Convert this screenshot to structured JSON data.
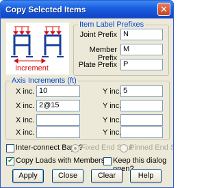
{
  "window": {
    "title": "Copy Selected Items"
  },
  "diagram": {
    "caption": "Increment"
  },
  "prefixes": {
    "legend": "Item Label Prefixes",
    "joint_label": "Joint Prefix",
    "joint_value": "N",
    "member_label": "Member Prefix",
    "member_value": "M",
    "plate_label": "Plate Prefix",
    "plate_value": "P"
  },
  "increments": {
    "legend": "Axis Increments (ft)",
    "rows": [
      {
        "x_label": "X inc.",
        "x_value": "10",
        "y_label": "Y inc.",
        "y_value": "5"
      },
      {
        "x_label": "X inc.",
        "x_value": "2@15",
        "y_label": "Y inc.",
        "y_value": ""
      },
      {
        "x_label": "X inc.",
        "x_value": "",
        "y_label": "Y inc.",
        "y_value": ""
      },
      {
        "x_label": "X inc.",
        "x_value": "",
        "y_label": "Y inc.",
        "y_value": ""
      }
    ]
  },
  "options": {
    "interconnect_label": "Inter-connect Bays?",
    "interconnect_checked": false,
    "fixed_end_label": "Fixed End Strut",
    "pinned_end_label": "Pinned End Strut",
    "copy_loads_label": "Copy Loads with Members?",
    "copy_loads_checked": true,
    "keep_open_label": "Keep this dialog open?",
    "keep_open_checked": false
  },
  "buttons": {
    "apply": "Apply",
    "close": "Close",
    "clear": "Clear",
    "help": "Help"
  },
  "colors": {
    "accent": "#0046d5",
    "diagram_line": "#1a3e9a",
    "diagram_accent": "#d01010"
  }
}
